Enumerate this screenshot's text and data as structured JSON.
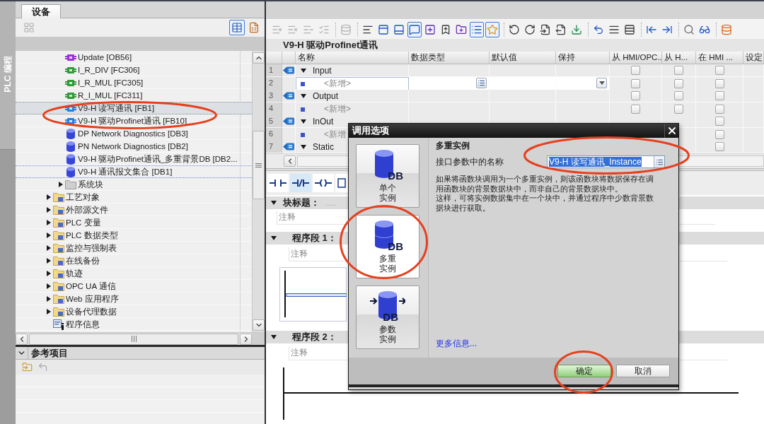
{
  "side_tab": {
    "label": "PLC 编程",
    "selected": true
  },
  "project_tree": {
    "tabs": [
      {
        "label": "设备",
        "selected": true
      }
    ],
    "toolbar": {
      "groups": [
        {
          "buttons": [
            {
              "disabled": true,
              "pressed": false
            }
          ]
        },
        {
          "buttons": [
            {
              "disabled": false,
              "pressed": true
            },
            {
              "disabled": false,
              "pressed": false
            }
          ]
        }
      ]
    },
    "items": [
      {
        "children": [
          {
            "kind": "ob",
            "label": "Update [OB56]",
            "selected": false,
            "focused": false,
            "circled": false
          },
          {
            "kind": "fc",
            "label": "I_R_DIV [FC306]",
            "selected": false,
            "focused": false,
            "circled": false
          },
          {
            "kind": "fc",
            "label": "I_R_MUL [FC305]",
            "selected": false,
            "focused": false,
            "circled": false
          },
          {
            "kind": "fc",
            "label": "R_I_MUL [FC311]",
            "selected": false,
            "focused": false,
            "circled": false
          },
          {
            "kind": "fb",
            "label": "V9-H 读写通讯 [FB1]",
            "selected": true,
            "focused": false,
            "circled": true
          },
          {
            "kind": "fb",
            "label": "V9-H 驱动Profinet通讯 [FB10]",
            "selected": false,
            "focused": false,
            "circled": false
          },
          {
            "kind": "db",
            "label": "DP Network Diagnostics [DB3]",
            "selected": false,
            "focused": false,
            "circled": false
          },
          {
            "kind": "db",
            "label": "PN Network Diagnostics [DB2]",
            "selected": false,
            "focused": false,
            "circled": false
          },
          {
            "kind": "db",
            "label": "V9-H 驱动Profinet通讯_多重背景DB [DB2...",
            "selected": false,
            "focused": false,
            "circled": false
          },
          {
            "kind": "db",
            "label": "V9-H 通讯报文集合 [DB1]",
            "selected": false,
            "focused": true,
            "circled": false
          },
          {
            "kind": "system",
            "label": "系统块",
            "expanded": false,
            "selected": false,
            "focused": false,
            "circled": false
          }
        ]
      },
      {
        "kind": "folder",
        "label": "工艺对象",
        "expanded": false,
        "selected": false,
        "focused": false,
        "circled": false
      },
      {
        "kind": "folder",
        "label": "外部源文件",
        "expanded": false,
        "selected": false,
        "focused": false,
        "circled": false
      },
      {
        "kind": "folder",
        "label": "PLC 变量",
        "expanded": false,
        "selected": false,
        "focused": false,
        "circled": false
      },
      {
        "kind": "folder",
        "label": "PLC 数据类型",
        "expanded": false,
        "selected": false,
        "focused": false,
        "circled": false
      },
      {
        "kind": "folder",
        "label": "监控与强制表",
        "expanded": false,
        "selected": false,
        "focused": false,
        "circled": false
      },
      {
        "kind": "folder",
        "label": "在线备份",
        "expanded": false,
        "selected": false,
        "focused": false,
        "circled": false
      },
      {
        "kind": "folder",
        "label": "轨迹",
        "expanded": false,
        "selected": false,
        "focused": false,
        "circled": false
      },
      {
        "kind": "folder",
        "label": "OPC UA 通信",
        "expanded": false,
        "selected": false,
        "focused": false,
        "circled": false
      },
      {
        "kind": "folder",
        "label": "Web 应用程序",
        "expanded": false,
        "selected": false,
        "focused": false,
        "circled": false
      },
      {
        "kind": "folder",
        "label": "设备代理数据",
        "expanded": false,
        "selected": false,
        "focused": false,
        "circled": false
      },
      {
        "kind": "info",
        "label": "程序信息",
        "selected": false,
        "focused": false,
        "circled": false
      }
    ]
  },
  "references": {
    "title": "参考项目",
    "expanded": true,
    "toolbar": {
      "buttons": [
        {
          "disabled": false
        },
        {
          "disabled": true
        }
      ]
    }
  },
  "editor": {
    "toolbar": {
      "groups": [
        {
          "buttons": [
            {
              "disabled": true,
              "pressed": false
            },
            {
              "disabled": true,
              "pressed": false
            },
            {
              "disabled": true,
              "pressed": false
            },
            {
              "disabled": true,
              "pressed": false
            }
          ]
        },
        {
          "buttons": [
            {
              "disabled": true,
              "pressed": false
            }
          ]
        },
        {
          "buttons": [
            {
              "disabled": false,
              "pressed": false
            },
            {
              "disabled": false,
              "pressed": false
            },
            {
              "disabled": false,
              "pressed": false
            },
            {
              "disabled": false,
              "pressed": true
            },
            {
              "disabled": false,
              "pressed": false
            },
            {
              "disabled": false,
              "pressed": false
            },
            {
              "disabled": false,
              "pressed": false
            },
            {
              "disabled": false,
              "pressed": true
            },
            {
              "disabled": false,
              "pressed": true
            }
          ]
        },
        {
          "buttons": [
            {
              "disabled": false,
              "pressed": false
            },
            {
              "disabled": false,
              "pressed": false
            },
            {
              "disabled": false,
              "pressed": false
            },
            {
              "disabled": false,
              "pressed": false
            },
            {
              "disabled": false,
              "pressed": false
            }
          ]
        },
        {
          "buttons": [
            {
              "disabled": false,
              "pressed": false
            },
            {
              "disabled": false,
              "pressed": false
            },
            {
              "disabled": false,
              "pressed": false
            }
          ]
        },
        {
          "buttons": [
            {
              "disabled": false,
              "pressed": false
            },
            {
              "disabled": false,
              "pressed": false
            }
          ]
        },
        {
          "buttons": [
            {
              "disabled": false,
              "pressed": false
            },
            {
              "disabled": false,
              "pressed": false
            }
          ]
        },
        {
          "buttons": [
            {
              "disabled": false,
              "pressed": false
            }
          ]
        }
      ]
    },
    "block_name": "V9-H 驱动Profinet通讯",
    "interface": {
      "columns": [
        "名称",
        "数据类型",
        "默认值",
        "保持",
        "从 HMI/OPC..",
        "从 H...",
        "在 HMI ...",
        "设定"
      ],
      "rows": [
        {
          "number": "1",
          "kind": "section",
          "name": "Input",
          "expanded": true,
          "selected": false,
          "checkboxes": [
            {
              "checked": false
            },
            {
              "checked": false
            },
            {
              "checked": false
            }
          ]
        },
        {
          "number": "2",
          "kind": "new",
          "name": "<新增>",
          "selected": true,
          "checkboxes": [
            {
              "checked": false
            },
            {
              "checked": false
            },
            {
              "checked": false
            }
          ]
        },
        {
          "number": "3",
          "kind": "section",
          "name": "Output",
          "expanded": true,
          "selected": false,
          "checkboxes": [
            {
              "checked": false
            },
            {
              "checked": false
            },
            {
              "checked": false
            }
          ]
        },
        {
          "number": "4",
          "kind": "new",
          "name": "<新增>",
          "selected": false,
          "checkboxes": [
            {
              "checked": false
            },
            {
              "checked": false
            },
            {
              "checked": false
            }
          ]
        },
        {
          "number": "5",
          "kind": "section",
          "name": "InOut",
          "expanded": true,
          "selected": false,
          "checkboxes": [
            {
              "checked": false
            }
          ]
        },
        {
          "number": "6",
          "kind": "new",
          "name": "<新增",
          "selected": false,
          "checkboxes": [
            {
              "checked": false
            }
          ]
        },
        {
          "number": "7",
          "kind": "section",
          "name": "Static",
          "expanded": true,
          "selected": false,
          "checkboxes": [
            {
              "checked": false
            }
          ]
        }
      ]
    },
    "ladder_toolbar": {
      "buttons": [
        {
          "pressed": false
        },
        {
          "pressed": true
        },
        {
          "pressed": false
        },
        {
          "pressed": false
        }
      ]
    },
    "block_title": {
      "label": "块标题：",
      "placeholder": ".....",
      "expanded": true
    },
    "block_comment": {
      "placeholder": "注释"
    },
    "networks": [
      {
        "title": "程序段 1：",
        "expanded": true,
        "comment": {
          "placeholder": "注释"
        },
        "rung_selected": true
      },
      {
        "title": "程序段 2：",
        "expanded": true,
        "comment": {
          "placeholder": "注释"
        },
        "rung_selected": false
      }
    ]
  },
  "dialog": {
    "title": "调用选项",
    "options": [
      {
        "kind": "single",
        "label": "单个实例",
        "badge": "DB",
        "selected": false,
        "circled": false
      },
      {
        "kind": "multi",
        "label": "多重实例",
        "badge": "DB",
        "selected": true,
        "circled": true
      },
      {
        "kind": "parameter",
        "label": "参数实例",
        "badge": "DB",
        "selected": false,
        "circled": false
      }
    ],
    "heading": "多重实例",
    "name_field": {
      "label": "接口参数中的名称",
      "value": "V9-H 读写通讯_Instance",
      "value_selected": true,
      "circled": true
    },
    "description": [
      "如果将函数块调用为一个多重实例，则该函数块将数据保存在调用函数块的背景数据块中，而非自己的背景数据块中。",
      "这样，可将实例数据集中在一个块中，并通过程序中少数背景数据块进行获取。"
    ],
    "more_info": "更多信息...",
    "buttons": [
      {
        "label": "确定",
        "default": true,
        "circled": true
      },
      {
        "label": "取消",
        "default": false,
        "circled": false
      }
    ]
  }
}
